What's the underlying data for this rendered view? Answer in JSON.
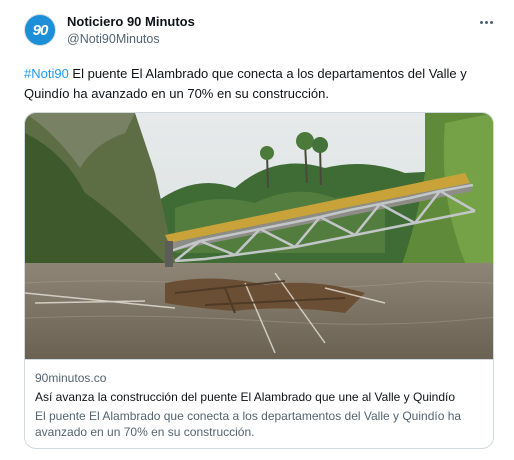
{
  "author": {
    "name": "Noticiero 90 Minutos",
    "handle": "@Noti90Minutos",
    "avatar_logo": "90"
  },
  "menu_icon": "more-dots-icon",
  "tweet": {
    "hashtag": "#Noti90",
    "text": " El puente El Alambrado que conecta a los departamentos del Valle y Quindío ha avanzado en un 70% en su construcción."
  },
  "card": {
    "image_alt": "Puente El Alambrado sobre el río",
    "domain": "90minutos.co",
    "title": "Así avanza la construcción del puente El Alambrado que une al Valle y Quindío",
    "description": "El puente El Alambrado que conecta a los departamentos del Valle y Quindío ha avanzado en un 70% en su construcción."
  },
  "colors": {
    "link": "#1d9bf0",
    "secondary_text": "#536471",
    "border": "#cfd9de",
    "avatar_bg": "#1d8fd6"
  }
}
